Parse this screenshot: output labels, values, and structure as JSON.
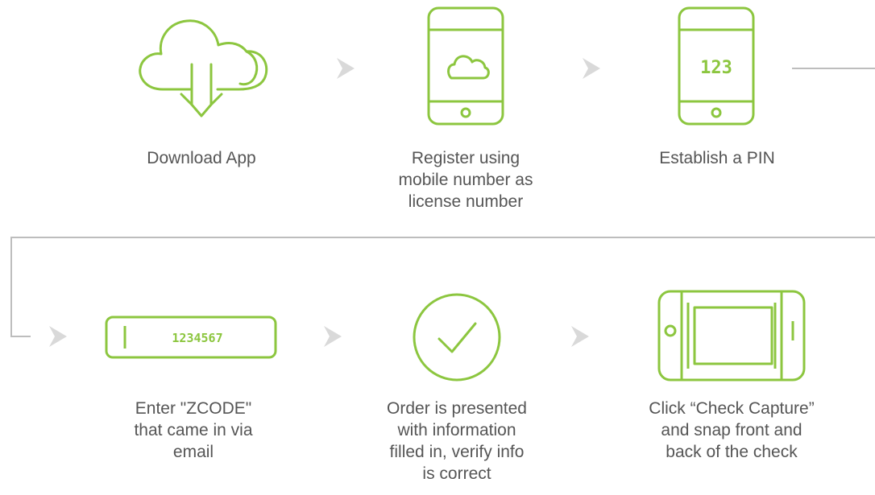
{
  "colors": {
    "accent": "#8cc63f",
    "connector": "#bdbdbd",
    "arrow": "#d9d9d9",
    "text": "#555555"
  },
  "steps": [
    {
      "icon": "cloud-download-icon",
      "label": "Download App"
    },
    {
      "icon": "phone-cloud-icon",
      "label": "Register using\nmobile number as\nlicense number"
    },
    {
      "icon": "phone-pin-icon",
      "pin_text": "123",
      "label": "Establish a PIN"
    },
    {
      "icon": "code-field-icon",
      "code_text": "1234567",
      "label": "Enter \"ZCODE\"\nthat came in via\nemail"
    },
    {
      "icon": "checkmark-circle-icon",
      "label": "Order is presented\nwith information\nfilled in, verify info\nis correct"
    },
    {
      "icon": "phone-landscape-capture-icon",
      "label": "Click “Check Capture”\nand snap front and\nback of the check"
    }
  ]
}
